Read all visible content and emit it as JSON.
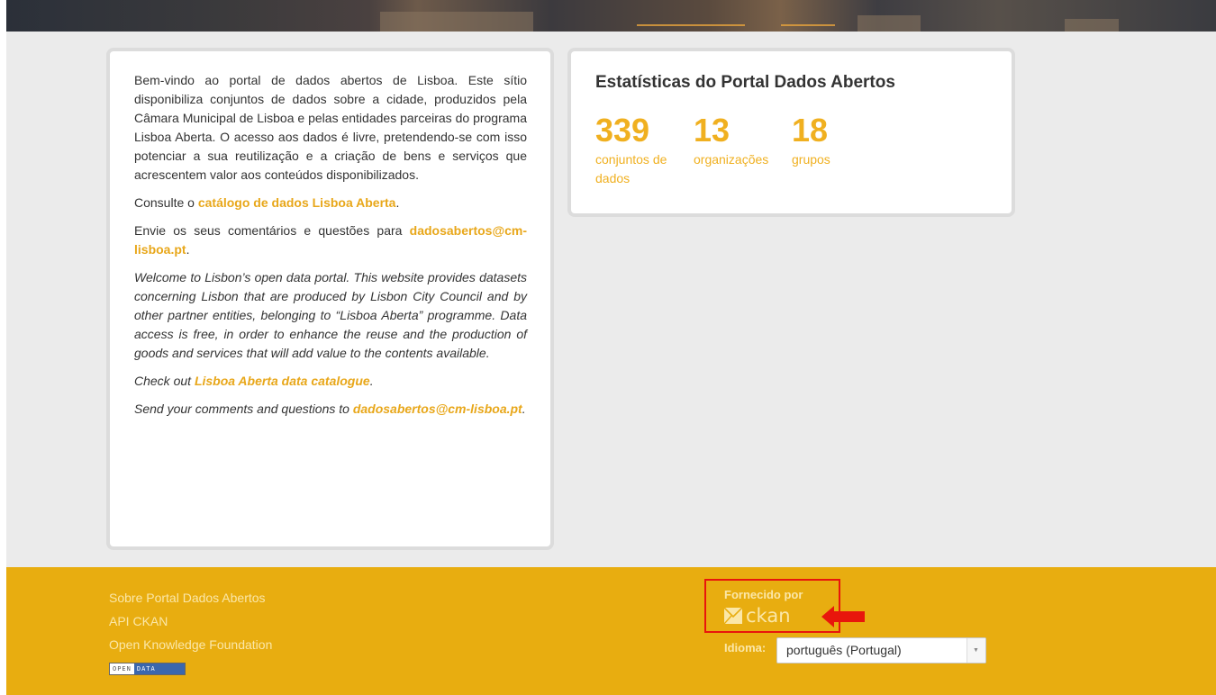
{
  "intro": {
    "pt_paragraph": "Bem-vindo ao portal de dados abertos de Lisboa. Este sítio disponibiliza conjuntos de dados sobre a cidade, produzidos pela Câmara Municipal de Lisboa e pelas entidades parceiras do programa Lisboa Aberta. O acesso aos dados é livre, pretendendo-se com isso potenciar a sua reutilização e a criação de bens e serviços que acrescentem valor aos conteúdos disponibilizados.",
    "pt_catalog_prefix": "Consulte o ",
    "pt_catalog_link": "catálogo de dados Lisboa Aberta",
    "pt_catalog_suffix": ".",
    "pt_contact_prefix": "Envie os seus comentários e questões para ",
    "pt_contact_link": "dadosabertos@cm-lisboa.pt",
    "pt_contact_suffix": ".",
    "en_paragraph": "Welcome to Lisbon’s open data portal. This website provides datasets concerning Lisbon that are produced by Lisbon City Council and by other partner entities, belonging to “Lisboa Aberta” programme. Data access is free, in order to enhance the reuse and the production of goods and services that will add value to the contents available.",
    "en_catalog_prefix": "Check out ",
    "en_catalog_link": "Lisboa Aberta data catalogue",
    "en_catalog_suffix": ".",
    "en_contact_prefix": "Send your comments and questions to ",
    "en_contact_link": "dadosabertos@cm-lisboa.pt",
    "en_contact_suffix": "."
  },
  "stats": {
    "title": "Estatísticas do Portal Dados Abertos",
    "items": [
      {
        "value": "339",
        "label": "conjuntos de dados"
      },
      {
        "value": "13",
        "label": "organizações"
      },
      {
        "value": "18",
        "label": "grupos"
      }
    ]
  },
  "footer": {
    "links": [
      "Sobre Portal Dados Abertos",
      "API CKAN",
      "Open Knowledge Foundation"
    ],
    "open_data_badge": [
      "OPEN",
      "DATA"
    ],
    "powered_by": "Fornecido por",
    "ckan_logo": "ckan",
    "language_label": "Idioma:",
    "language_value": "português (Portugal)"
  },
  "colors": {
    "accent": "#f0b020",
    "footer_bg": "#e8ad10",
    "highlight": "#e8160c"
  }
}
